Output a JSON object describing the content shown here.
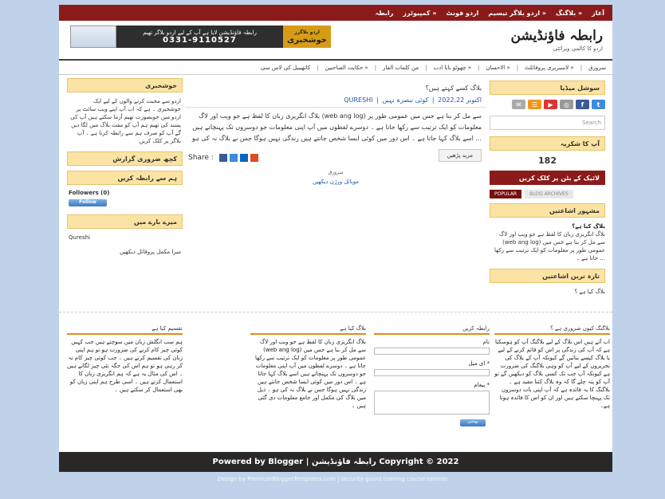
{
  "topbar": {
    "items": [
      "آغاز",
      "بلاگنگ »",
      "اردو بلاگر تیسیم »",
      "اردو فونٹ",
      "کمپیوٹرز »",
      "رابطہ"
    ]
  },
  "header": {
    "logo_title": "رابطہ فاؤنڈیشن",
    "logo_subtitle": "اردو کا کالمی ویرائٹی",
    "banner": {
      "text": "رابطہ فاؤنڈیشن لایا ہے آپ کے لیے اردو بلاگر تھیم",
      "phone": "0331-9110527",
      "badge": "خوشخبری",
      "badge_small": "اردو بلاگرز"
    }
  },
  "nav": {
    "items": [
      "سرورق",
      "لاسبریری پروفائلٹ »",
      "الاحسان »",
      "چھوٹو بابا ادب »",
      "من کلمات الفار",
      "حکایت الصاحبین »",
      "کاتھیبیل کی لاس سی"
    ]
  },
  "right_sidebar": {
    "social_title": "سوشل میڈیا",
    "search_placeholder": "Search",
    "visitors_title": "آپ کا شکریہ",
    "visitors_count": "182",
    "facebook_title": "لائیک کے بٹن پر کلک کریں",
    "tab_popular": "POPULAR",
    "tab_archives": "BLOG ARCHIVES",
    "popular_title": "مشہور اشاعتیں",
    "popular_post_title": "بلاگ کیا ہے؟",
    "popular_post_text": "بلاگ انگریزی زبان کا لفظ ہے جو ویب اور لاگ (web ang log) سے مل کر بنا ہے جس میں عمومی طور پر معلومات کو ایک ترتیب سے رکھا جاتا ہے ۔ ...",
    "recent_title": "تازہ ترین اشاعتیں",
    "recent_item": "بلاگ کیا ہے ؟"
  },
  "left_sidebar": {
    "news_title": "خوشخبری",
    "news_text": "اردو سے محبت کرنے والوں کے لیے ایک خوشخبری ۔ ہے کہ اب آپ اپنے ویب سائٹ پر اردو میں خوبصورت تھیم آزما سکتے ہیں آپ کی پسند کی تھیم ہم آپ کو مفت بلاگ میں لگا دیں گے آپ کو صرف ہم سے رابطہ کرنا ہے ۔ آپ بلاگر پر کلک کریں",
    "report_title": "کچھ ضروری گزارش",
    "follow_title": "ہم سے رابطہ کریں",
    "followers_label": "Followers (0)",
    "follow_button": "Follow",
    "about_title": "میرے بارے میں",
    "about_name": "Qureshi",
    "about_link": "میرا مکمل پروفائل دیکھیں"
  },
  "post": {
    "title": "بلاگ کسے کہتے ہیں؟",
    "meta": "QURESHI ❘ اکتوبر 2022,22 ❘ کوئی تبصرہ نہیں",
    "body": "بلاگ انگریزی زبان کا لفظ ہے جو ویب اور لاگ (web ang log) سے مل کر بنا ہے جس میں عمومی طور پر معلومات کو ایک ترتیب سے رکھا جاتا ہے ۔ دوسرے لفظوں میں آپ اپنی معلومات جو دوسروں تک پہنچاتے ہیں اسے بلاگ کہا جاتا ہے ۔ اس دور میں کوئی ایسا شخص جانتے ہیں زندگی نہیں ہوگا جس نے بلاگ نہ کی ہو ...",
    "read_more": "مزید پڑھیں",
    "share_label": "Share :",
    "home_link": "سرورق",
    "mobile_link": "موبائل ورژن دیکھیں"
  },
  "footer": {
    "col1_title": "بلاگنگ کیوں ضروری ہے ؟",
    "col1_text": "اب آتے ہیں اس بلاگ کے لیے بلاگنگ آپ کو ہوسکتا ہے کہ آپ کی زندگی پر اس کو قائم کرنے کے لیے یا بلاگ کیسے بنائیں گے کیونکہ آپ کے بلاگ کی تحریروں کے لیے آپ کو وہی بلاگنگ کی ضرورت ہے کیونکہ آپ جب تک کسی بلاگ کو دیکھیں گے تو آپ کو پتہ چلے گا کہ وہ بلاگ کتنا مفید ہے ۔ بلاگنگ کا یہ فائدہ ہے کہ آپ اپنی بات دوسروں تک پہنچا سکتے ہیں اور ان کو اس کا فائدہ ہوتا ہے۔",
    "col2_title": "رابطہ کریں",
    "name_label": "نام",
    "email_label": "ای میل *",
    "message_label": "پیغام *",
    "send_button": "بھیجیں",
    "col3_title": "بلاگ کیا ہے",
    "col3_text": "بلاگ انگریزی زبان کا لفظ ہے جو ویب اور لاگ (web ang log) سے مل کر بنا ہے جس میں عمومی طور پر معلومات کو ایک ترتیب سے رکھا جاتا ہے ۔ دوسرے لفظوں میں آپ اپنی معلومات جو دوسروں تک پہنچاتے ہیں اسے بلاگ کہا جاتا ہے ۔ اس دور میں کوئی ایسا شخص جانتے ہیں زندگی نہیں ہوگا جس نے بلاگ نہ کی ہو ۔ ذیل میں بلاگ کی مکمل اور جامع معلومات دی گئی ہیں ۔",
    "col4_title": "تقسیم کیا ہے",
    "col4_text": "ہم سب انگلش زبان میں سوچتے ہیں جب کہیں کوئی چیز کام کرنے کی ضرورت ہو تو ہم اپنی زبان کی تقسیم کرتے ہیں ۔ جب کوئی چیز کام نہ کر رہی ہو تو ہم اس کی جگہ نئی چیز لگاتے ہیں ۔ اس کی مثال یہ ہے کہ ہم انگریزی زبان کا استعمال کرتے ہیں ۔ اسی طرح ہم اپنی زبان کو بھی استعمال کر سکتے ہیں ۔"
  },
  "bottom": {
    "text": "Powered by Blogger | رابطہ فاؤنڈیشن Copyright © 2022"
  },
  "credit": {
    "text": "Design by PremiumBloggerTemplates.com | security guard training course toronto"
  }
}
